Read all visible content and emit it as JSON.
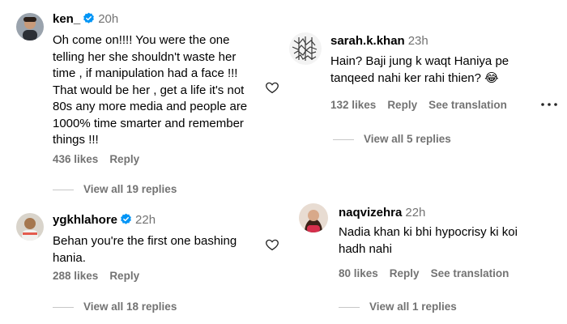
{
  "colors": {
    "secondary_text": "#737373",
    "verified": "#0095f6",
    "divider": "#c7c7c7"
  },
  "comments": [
    {
      "username": "ken_",
      "time": "20h",
      "verified": true,
      "avatar_icon": "avatar-photo",
      "text_lines": [
        "Oh come on!!!! You were the one",
        "telling her she shouldn't waste her",
        "time , if manipulation had a face !!!",
        "That would be her , get a life it's not",
        "80s any more media and people are",
        "1000% time smarter and remember",
        "things !!!"
      ],
      "likes": "436 likes",
      "reply": "Reply",
      "view_replies": "View all 19 replies"
    },
    {
      "username": "ygkhlahore",
      "time": "22h",
      "verified": true,
      "avatar_icon": "avatar-photo",
      "text_lines": [
        "Behan you're the first one bashing",
        "hania."
      ],
      "likes": "288 likes",
      "reply": "Reply",
      "view_replies": "View all 18 replies"
    },
    {
      "username": "sarah.k.khan",
      "time": "23h",
      "verified": false,
      "avatar_icon": "avatar-pattern",
      "text_lines": [
        "Hain? Baji jung k waqt Haniya pe",
        "tanqeed nahi ker rahi thien? 😂"
      ],
      "likes": "132 likes",
      "reply": "Reply",
      "see_translation": "See translation",
      "view_replies": "View all 5 replies"
    },
    {
      "username": "naqvizehra",
      "time": "22h",
      "verified": false,
      "avatar_icon": "avatar-photo",
      "text_lines": [
        "Nadia khan ki bhi hypocrisy ki koi",
        "hadh nahi"
      ],
      "likes": "80 likes",
      "reply": "Reply",
      "see_translation": "See translation",
      "view_replies": "View all 1 replies"
    }
  ]
}
